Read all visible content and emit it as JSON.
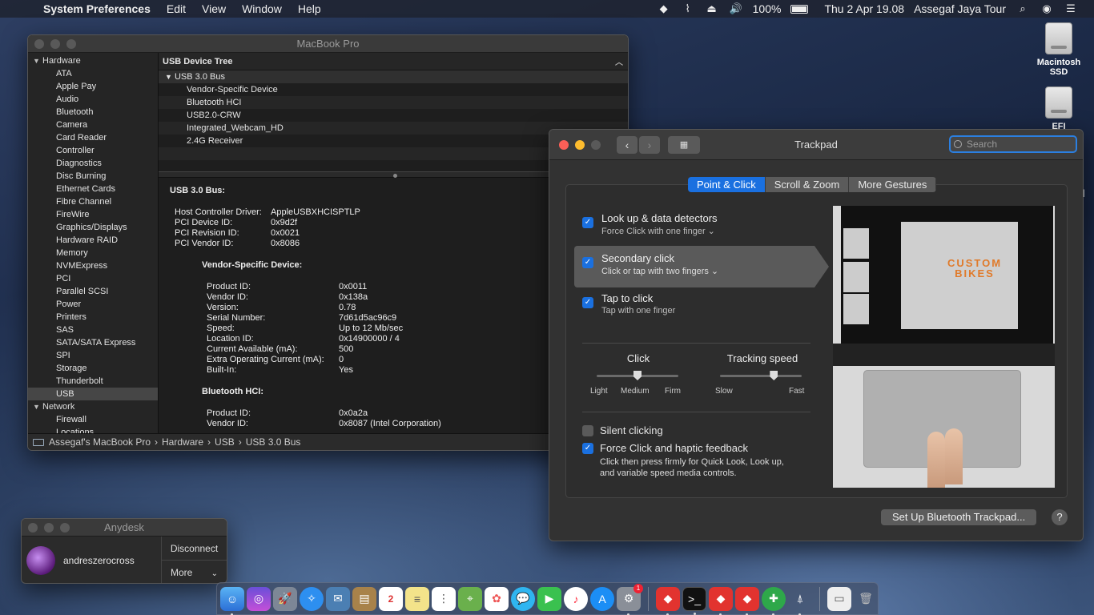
{
  "menubar": {
    "app": "System Preferences",
    "items": [
      "Edit",
      "View",
      "Window",
      "Help"
    ],
    "battery": "100%",
    "datetime": "Thu 2 Apr  19.08",
    "user": "Assegaf Jaya Tour"
  },
  "desktop": {
    "icons": [
      {
        "label": "Macintosh SSD"
      },
      {
        "label": "EFI"
      }
    ]
  },
  "sysinfo": {
    "title": "MacBook Pro",
    "sidebar": {
      "hardware_label": "Hardware",
      "hardware_items": [
        "ATA",
        "Apple Pay",
        "Audio",
        "Bluetooth",
        "Camera",
        "Card Reader",
        "Controller",
        "Diagnostics",
        "Disc Burning",
        "Ethernet Cards",
        "Fibre Channel",
        "FireWire",
        "Graphics/Displays",
        "Hardware RAID",
        "Memory",
        "NVMExpress",
        "PCI",
        "Parallel SCSI",
        "Power",
        "Printers",
        "SAS",
        "SATA/SATA Express",
        "SPI",
        "Storage",
        "Thunderbolt",
        "USB"
      ],
      "selected": "USB",
      "network_label": "Network",
      "network_items": [
        "Firewall",
        "Locations"
      ]
    },
    "tree": {
      "header": "USB Device Tree",
      "bus": "USB 3.0 Bus",
      "children": [
        "Vendor-Specific Device",
        "Bluetooth HCI",
        "USB2.0-CRW",
        "Integrated_Webcam_HD",
        "2.4G Receiver"
      ]
    },
    "detail": {
      "header": "USB 3.0 Bus:",
      "bus_fields": [
        {
          "k": "Host Controller Driver:",
          "v": "AppleUSBXHCISPTLP"
        },
        {
          "k": "PCI Device ID:",
          "v": "0x9d2f"
        },
        {
          "k": "PCI Revision ID:",
          "v": "0x0021"
        },
        {
          "k": "PCI Vendor ID:",
          "v": "0x8086"
        }
      ],
      "vendor_header": "Vendor-Specific Device:",
      "vendor_fields": [
        {
          "k": "Product ID:",
          "v": "0x0011"
        },
        {
          "k": "Vendor ID:",
          "v": "0x138a"
        },
        {
          "k": "Version:",
          "v": "0.78"
        },
        {
          "k": "Serial Number:",
          "v": "7d61d5ac96c9"
        },
        {
          "k": "Speed:",
          "v": "Up to 12 Mb/sec"
        },
        {
          "k": "Location ID:",
          "v": "0x14900000 / 4"
        },
        {
          "k": "Current Available (mA):",
          "v": "500"
        },
        {
          "k": "Extra Operating Current (mA):",
          "v": "0"
        },
        {
          "k": "Built-In:",
          "v": "Yes"
        }
      ],
      "bt_header": "Bluetooth HCI:",
      "bt_fields": [
        {
          "k": "Product ID:",
          "v": "0x0a2a"
        },
        {
          "k": "Vendor ID:",
          "v": "0x8087  (Intel Corporation)"
        }
      ]
    },
    "path": {
      "computer": "Assegaf's MacBook Pro",
      "sep": "›",
      "p1": "Hardware",
      "p2": "USB",
      "p3": "USB 3.0 Bus"
    }
  },
  "trackpad": {
    "title": "Trackpad",
    "search_placeholder": "Search",
    "tabs": [
      "Point & Click",
      "Scroll & Zoom",
      "More Gestures"
    ],
    "options": [
      {
        "title": "Look up & data detectors",
        "sub": "Force Click with one finger ⌄",
        "checked": true
      },
      {
        "title": "Secondary click",
        "sub": "Click or tap with two fingers ⌄",
        "checked": true
      },
      {
        "title": "Tap to click",
        "sub": "Tap with one finger",
        "checked": true
      }
    ],
    "click_slider": {
      "title": "Click",
      "labels": [
        "Light",
        "Medium",
        "Firm"
      ],
      "value": "Medium"
    },
    "tracking_slider": {
      "title": "Tracking speed",
      "labels": [
        "Slow",
        "Fast"
      ],
      "level": 0.66
    },
    "silent_clicking": {
      "label": "Silent clicking",
      "checked": false
    },
    "force_click": {
      "label": "Force Click and haptic feedback",
      "desc1": "Click then press firmly for Quick Look, Look up,",
      "desc2": "and variable speed media controls.",
      "checked": true
    },
    "preview_text": "CUSTOM BIKES",
    "setup_button": "Set Up Bluetooth Trackpad...",
    "help": "?"
  },
  "anydesk": {
    "title": "Anydesk",
    "user": "andreszerocross",
    "disconnect": "Disconnect",
    "more": "More"
  },
  "dock": {
    "badge": "1"
  }
}
